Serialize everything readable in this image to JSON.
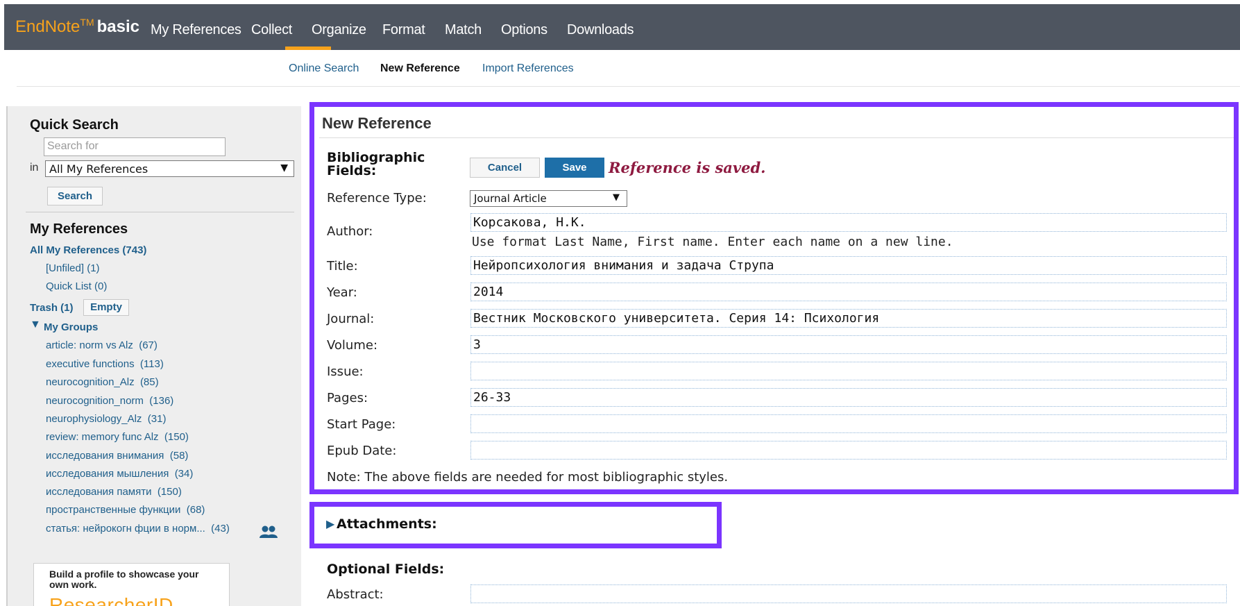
{
  "app": {
    "logo_endnote": "EndNote",
    "logo_tm": "TM",
    "logo_basic": "basic"
  },
  "nav": {
    "items": [
      "My References",
      "Collect",
      "Organize",
      "Format",
      "Match",
      "Options",
      "Downloads"
    ],
    "active": "Collect"
  },
  "subnav": {
    "items": [
      "Online Search",
      "New Reference",
      "Import References"
    ],
    "active": "New Reference"
  },
  "sidebar": {
    "quick_search_title": "Quick Search",
    "search_placeholder": "Search for",
    "in_label": "in",
    "scope_value": "All My References",
    "search_button": "Search",
    "my_refs_title": "My References",
    "all_refs": "All My References (743)",
    "unfiled": "[Unfiled] (1)",
    "quick_list": "Quick List (0)",
    "trash": "Trash (1)",
    "empty_button": "Empty",
    "my_groups": "My Groups",
    "groups": [
      {
        "label": "article: norm vs Alz",
        "count": "(67)"
      },
      {
        "label": "executive functions",
        "count": "(113)"
      },
      {
        "label": "neurocognition_Alz",
        "count": "(85)"
      },
      {
        "label": "neurocognition_norm",
        "count": "(136)"
      },
      {
        "label": "neurophysiology_Alz",
        "count": "(31)"
      },
      {
        "label": "review: memory func Alz",
        "count": "(150)"
      },
      {
        "label": "исследования внимания",
        "count": "(58)"
      },
      {
        "label": "исследования мышления",
        "count": "(34)"
      },
      {
        "label": "исследования памяти",
        "count": "(150)"
      },
      {
        "label": "пространственные функции",
        "count": "(68)"
      },
      {
        "label": "статья: нейрокогн фции в норм...",
        "count": "(43)"
      }
    ],
    "promo_text": "Build a profile to showcase your own work.",
    "promo_logo": "ResearcherID"
  },
  "form": {
    "title": "New Reference",
    "bib_label_line1": "Bibliographic",
    "bib_label_line2": "Fields:",
    "cancel": "Cancel",
    "save": "Save",
    "saved_message": "Reference is saved.",
    "reference_type_label": "Reference Type:",
    "reference_type_value": "Journal Article",
    "author_label": "Author:",
    "author_value": "Корсакова, Н.К.",
    "author_hint": "Use format Last Name, First name. Enter each name on a new line.",
    "title_label": "Title:",
    "title_value": "Нейропсихология внимания и задача Струпа",
    "year_label": "Year:",
    "year_value": "2014",
    "journal_label": "Journal:",
    "journal_value": "Вестник Московского университета. Серия 14: Психология",
    "volume_label": "Volume:",
    "volume_value": "3",
    "issue_label": "Issue:",
    "issue_value": "",
    "pages_label": "Pages:",
    "pages_value": "26-33",
    "start_page_label": "Start Page:",
    "start_page_value": "",
    "epub_date_label": "Epub Date:",
    "epub_date_value": "",
    "note": "Note: The above fields are needed for most bibliographic styles.",
    "attachments": "Attachments:",
    "optional_fields": "Optional Fields:",
    "abstract_label": "Abstract:"
  },
  "colors": {
    "highlight": "#7b35ff",
    "topbar": "#4e5560",
    "accent": "#f7a21b",
    "link": "#1f5f8b",
    "saved": "#8e1a40"
  }
}
